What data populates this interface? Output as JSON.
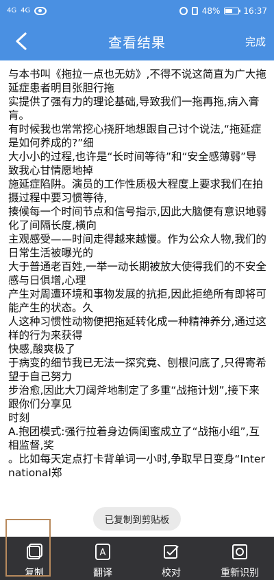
{
  "statusbar": {
    "left_signal_1": "4G",
    "left_signal_2": "4G",
    "battery": "48%",
    "time": "16:37"
  },
  "appbar": {
    "title": "查看结果",
    "done": "完成"
  },
  "content": {
    "lines": [
      "与本书叫《拖拉一点也无妨》,不得不说这简直为广大拖延症患者明目张胆行拖",
      "实提供了强有力的理论基础,导致我们一拖再拖,病入膏肓。",
      "有时候我也常常挖心挠肝地想跟自己讨个说法,“拖延症是如何养成的?”细",
      "大小小的过程,也许是“长时间等待”和“安全感薄弱”导致我心甘情愿地掉",
      "施延症陷阱。演员的工作性质极大程度上要求我们在拍摄过程中要习惯等待,",
      "揍候每一个时间节点和信号指示,因此大脑便有意识地弱化了间隔长度,横向",
      "主观感受——时间走得越来越慢。作为公众人物,我们的日常生活被曝光的",
      "大于普通老百姓,一举一动长期被放大使得我们的不安全感与日俱增,心理",
      "产生对周遭环境和事物发展的抗拒,因此拒绝所有即将可能产生的状态。久",
      "人这种习惯性动物便把拖延转化成一种精神养分,通过这样的行为来获得",
      "快感,酸爽极了",
      "于病变的细节我已无法一探究竟、刨根问底了,只得寄希望于自己努力",
      "步治愈,因此大刀阔斧地制定了多重“战拖计划”,接下来跟你们分享见",
      "时刻",
      "A.抱团模式:强行拉着身边俩闺蜜成立了“战拖小组”,互相监督,奖",
      "。比如每天定点打卡背单词一小时,争取早日变身“International郑"
    ]
  },
  "toast": "已复制到剪贴板",
  "bottombar": {
    "copy": "复制",
    "translate": "翻译",
    "proofread": "校对",
    "rerecognize": "重新识别"
  }
}
